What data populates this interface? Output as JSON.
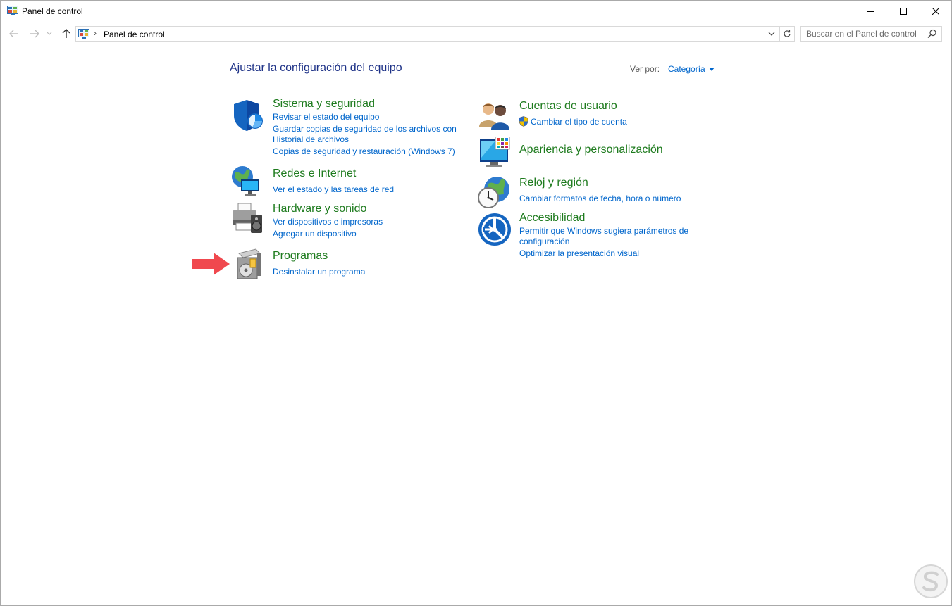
{
  "window": {
    "title": "Panel de control",
    "minimize_label": "—",
    "maximize_label": "□",
    "close_label": "✕"
  },
  "address": {
    "path_label": "Panel de control",
    "search_placeholder": "Buscar en el Panel de control"
  },
  "header": {
    "title": "Ajustar la configuración del equipo",
    "view_by_label": "Ver por:",
    "view_by_value": "Categoría"
  },
  "categories": [
    {
      "icon": "shield-icon",
      "title": "Sistema y seguridad",
      "links": [
        "Revisar el estado del equipo",
        "Guardar copias de seguridad de los archivos con",
        "Historial de archivos",
        "Copias de seguridad y restauración (Windows 7)"
      ]
    },
    {
      "icon": "network-globe-icon",
      "title": "Redes e Internet",
      "links": [
        "Ver el estado y las tareas de red"
      ]
    },
    {
      "icon": "printer-speaker-icon",
      "title": "Hardware y sonido",
      "links": [
        "Ver dispositivos e impresoras",
        "Agregar un dispositivo"
      ]
    },
    {
      "icon": "programs-disc-icon",
      "title": "Programas",
      "links": [
        "Desinstalar un programa"
      ]
    },
    {
      "icon": "users-icon",
      "title": "Cuentas de usuario",
      "links": [
        "Cambiar el tipo de cuenta"
      ]
    },
    {
      "icon": "monitor-palette-icon",
      "title": "Apariencia y personalización",
      "links": []
    },
    {
      "icon": "clock-globe-icon",
      "title": "Reloj y región",
      "links": [
        "Cambiar formatos de fecha, hora o número"
      ]
    },
    {
      "icon": "accessibility-icon",
      "title": "Accesibilidad",
      "links": [
        "Permitir que Windows sugiera parámetros de",
        "configuración",
        "Optimizar la presentación visual"
      ]
    }
  ],
  "colors": {
    "heading_blue": "#1e3287",
    "category_green": "#1e7b1e",
    "link_blue": "#0066cc",
    "annotation_red": "#f0484e"
  }
}
